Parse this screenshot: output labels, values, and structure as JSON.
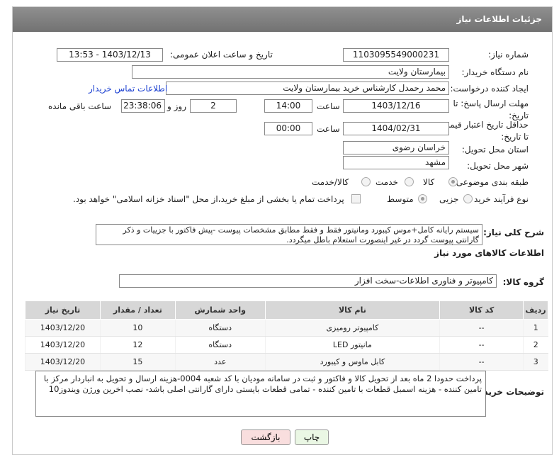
{
  "header": {
    "title": "جزئیات اطلاعات نیاز"
  },
  "fields": {
    "need_number_label": "شماره نیاز:",
    "need_number": "1103095549000231",
    "announce_label": "تاریخ و ساعت اعلان عمومی:",
    "announce_value": "1403/12/13 - 13:53",
    "buyer_label": "نام دستگاه خریدار:",
    "buyer_value": "بیمارستان ولایت",
    "creator_label": "ایجاد کننده درخواست:",
    "creator_value": "محمد رحمدل کارشناس خرید بیمارستان ولایت",
    "contact_link": "اطلاعات تماس خریدار",
    "deadline_label": "مهلت ارسال پاسخ: تا تاریخ:",
    "deadline_date": "1403/12/16",
    "time_label": "ساعت",
    "deadline_time": "14:00",
    "deadline_days": "2",
    "days_label": "روز و",
    "remaining_time": "23:38:06",
    "remaining_label": "ساعت باقی مانده",
    "validity_label": "حداقل تاریخ اعتبار قیمت: تا تاریخ:",
    "validity_date": "1404/02/31",
    "validity_time": "00:00",
    "province_label": "استان محل تحویل:",
    "province_value": "خراسان رضوی",
    "city_label": "شهر محل تحویل:",
    "city_value": "مشهد",
    "category_label": "طبقه بندی موضوعی:",
    "category_options": [
      "کالا",
      "خدمت",
      "کالا/خدمت"
    ],
    "process_label": "نوع فرآیند خرید :",
    "process_options": [
      "جزیی",
      "متوسط"
    ],
    "payment_note": "پرداخت تمام یا بخشی از مبلغ خرید،از محل \"اسناد خزانه اسلامی\" خواهد بود.",
    "description_label": "شرح کلی نیاز:",
    "description_value": "سیستم رایانه کامل+موس کیبورد ومانیتور فقط و فقط مطابق مشخصات پیوست -پیش فاکتور با جزییات و ذکر گارانتی پیوست گردد در غیر اینصورت استعلام باطل میگردد."
  },
  "goods_section": {
    "title": "اطلاعات کالاهای مورد نیاز",
    "group_label": "گروه کالا:",
    "group_value": "کامپیوتر و فناوری اطلاعات-سخت افزار"
  },
  "table": {
    "headers": [
      "ردیف",
      "کد کالا",
      "نام کالا",
      "واحد شمارش",
      "تعداد / مقدار",
      "تاریخ نیاز"
    ],
    "rows": [
      [
        "1",
        "--",
        "کامپیوتر رومیزی",
        "دستگاه",
        "10",
        "1403/12/20"
      ],
      [
        "2",
        "--",
        "مانیتور LED",
        "دستگاه",
        "12",
        "1403/12/20"
      ],
      [
        "3",
        "--",
        "کابل ماوس و کیبورد",
        "عدد",
        "15",
        "1403/12/20"
      ]
    ]
  },
  "buyer_notes": {
    "label": "توضیحات خریدار:",
    "value": "پرداخت حدودا 2 ماه بعد از تحویل کالا و فاکتور و ثبت در سامانه مودیان با کد شعبه 0004-هزینه ارسال و تحویل به انباردار مرکز با تامین کننده - هزینه اسمبل قطعات با تامین کننده - تمامی قطعات بایستی دارای گارانتی اصلی باشد- نصب اخرین ورژن ویندوز10"
  },
  "buttons": {
    "print": "چاپ",
    "back": "بازگشت"
  },
  "colors": {
    "header_bg": "#7f7f7f",
    "link": "#1a3fd1",
    "print_btn": "#eaf7e4",
    "back_btn": "#f9dede"
  }
}
